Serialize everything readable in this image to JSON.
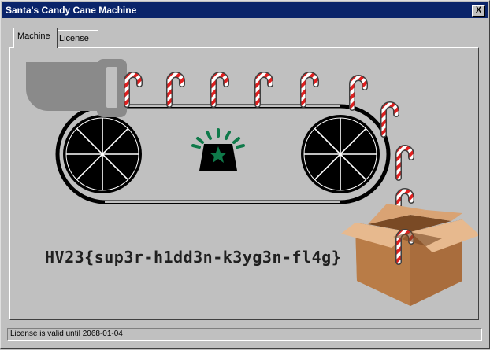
{
  "window": {
    "title": "Santa's Candy Cane Machine",
    "close_label": "X"
  },
  "tabs": [
    {
      "label": "Machine"
    },
    {
      "label": "License"
    }
  ],
  "machine": {
    "flag_text": "HV23{sup3r-h1dd3n-k3yg3n-fl4g}"
  },
  "status": {
    "text": "License is valid until 2068-01-04"
  },
  "colors": {
    "title_bar": "#0a246a",
    "window_bg": "#c0c0c0",
    "siren_light": "#0f7a4a",
    "box": "#c58a56",
    "cane_stripe": "#e11f1f"
  }
}
